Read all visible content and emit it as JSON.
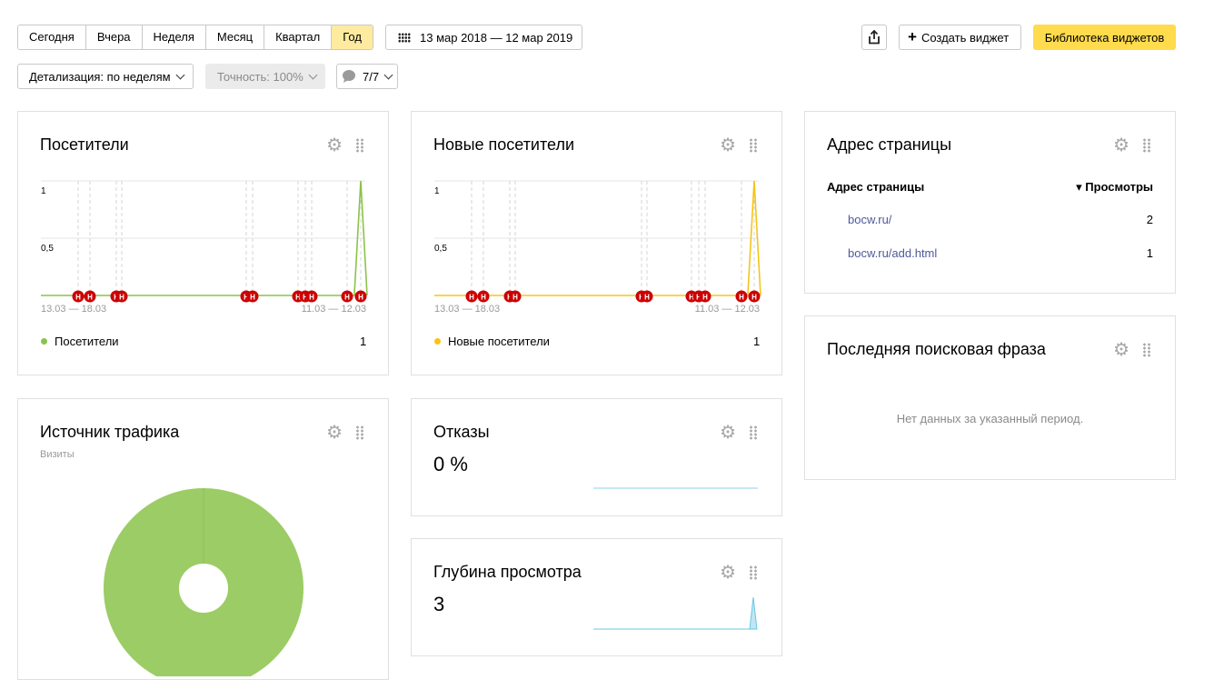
{
  "toolbar": {
    "periods": [
      "Сегодня",
      "Вчера",
      "Неделя",
      "Месяц",
      "Квартал",
      "Год"
    ],
    "active_period": "Год",
    "date_range": "13 мар 2018 — 12 мар 2019",
    "create_widget": "Создать виджет",
    "widget_library": "Библиотека виджетов",
    "detail": "Детализация: по неделям",
    "accuracy": "Точность: 100%",
    "segments": "7/7"
  },
  "widgets": {
    "visitors": {
      "title": "Посетители",
      "y_ticks": [
        "1",
        "0,5"
      ],
      "x_start": "13.03 — 18.03",
      "x_end": "11.03 — 12.03",
      "legend": "Посетители",
      "legend_value": "1",
      "color": "#8bc34a",
      "note_marker": "Н"
    },
    "new_visitors": {
      "title": "Новые посетители",
      "y_ticks": [
        "1",
        "0,5"
      ],
      "x_start": "13.03 — 18.03",
      "x_end": "11.03 — 12.03",
      "legend": "Новые посетители",
      "legend_value": "1",
      "color": "#f5c518",
      "note_marker": "Н"
    },
    "pages": {
      "title": "Адрес страницы",
      "col_page": "Адрес страницы",
      "col_views": "▾ Просмотры",
      "rows": [
        {
          "url": "bocw.ru/",
          "views": "2"
        },
        {
          "url": "bocw.ru/add.html",
          "views": "1"
        }
      ]
    },
    "search_phrase": {
      "title": "Последняя поисковая фраза",
      "empty": "Нет данных за указанный период."
    },
    "traffic": {
      "title": "Источник трафика",
      "subtitle": "Визиты",
      "color": "#9ccc65"
    },
    "bounces": {
      "title": "Отказы",
      "value": "0 %",
      "color": "#8fd3ea"
    },
    "depth": {
      "title": "Глубина просмотра",
      "value": "3",
      "color": "#8fd3ea"
    }
  },
  "icons": {
    "share": "share-icon",
    "plus": "plus-icon",
    "calendar": "calendar-icon",
    "comment": "comment-icon",
    "gear": "gear-icon",
    "drag": "drag-handle-icon"
  },
  "chart_data": [
    {
      "type": "line",
      "series": [
        {
          "name": "Посетители",
          "values": [
            0,
            0,
            0,
            0,
            0,
            0,
            0,
            0,
            0,
            0,
            0,
            0,
            0,
            0,
            0,
            0,
            0,
            0,
            0,
            0,
            0,
            0,
            0,
            0,
            0,
            0,
            0,
            0,
            0,
            0,
            0,
            0,
            0,
            0,
            0,
            0,
            0,
            0,
            0,
            0,
            0,
            0,
            0,
            0,
            0,
            0,
            0,
            0,
            0,
            0,
            1,
            0
          ]
        }
      ],
      "x_tick_labels": [
        "13.03 — 18.03",
        "11.03 — 12.03"
      ],
      "y_tick_labels": [
        "1",
        "0,5"
      ],
      "ylim": [
        0,
        1
      ],
      "grid": true
    },
    {
      "type": "line",
      "series": [
        {
          "name": "Новые посетители",
          "values": [
            0,
            0,
            0,
            0,
            0,
            0,
            0,
            0,
            0,
            0,
            0,
            0,
            0,
            0,
            0,
            0,
            0,
            0,
            0,
            0,
            0,
            0,
            0,
            0,
            0,
            0,
            0,
            0,
            0,
            0,
            0,
            0,
            0,
            0,
            0,
            0,
            0,
            0,
            0,
            0,
            0,
            0,
            0,
            0,
            0,
            0,
            0,
            0,
            0,
            0,
            1,
            0
          ]
        }
      ],
      "x_tick_labels": [
        "13.03 — 18.03",
        "11.03 — 12.03"
      ],
      "y_tick_labels": [
        "1",
        "0,5"
      ],
      "ylim": [
        0,
        1
      ],
      "grid": true
    },
    {
      "type": "pie",
      "slices": [
        {
          "label": "",
          "value": 100
        }
      ],
      "legend": false
    }
  ]
}
